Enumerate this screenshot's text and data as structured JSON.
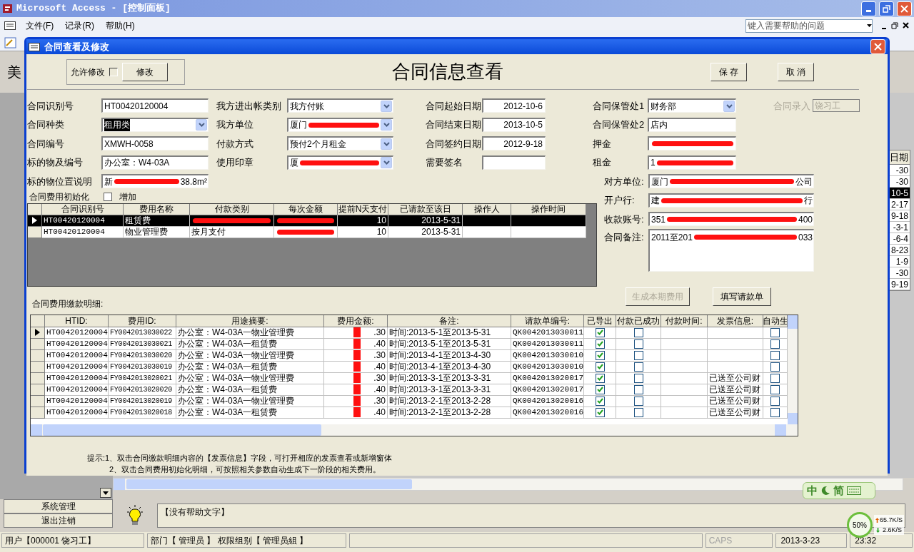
{
  "app": {
    "title": "Microsoft Access - [控制面板]",
    "menu": [
      "文件(F)",
      "记录(R)",
      "帮助(H)"
    ],
    "help_placeholder": "键入需要帮助的问题"
  },
  "background": {
    "big_char": "美",
    "date_header": "日期",
    "dates": [
      {
        "text": "-30",
        "selected": false
      },
      {
        "text": "-30",
        "selected": false
      },
      {
        "text": "10-5",
        "selected": true
      },
      {
        "text": "2-17",
        "selected": false
      },
      {
        "text": "9-18",
        "selected": false
      },
      {
        "text": "-3-1",
        "selected": false
      },
      {
        "text": "-6-4",
        "selected": false
      },
      {
        "text": "8-23",
        "selected": false
      },
      {
        "text": "1-9",
        "selected": false
      },
      {
        "text": "-30",
        "selected": false
      },
      {
        "text": "9-19",
        "selected": false
      }
    ],
    "nav": [
      "系统管理",
      "退出注销"
    ],
    "help_text": "【没有帮助文字】"
  },
  "status_bar": {
    "user": "用户【000001 饶习工】",
    "dept": "部门【 管理员 】 权限组别【 管理员組 】",
    "caps": "CAPS",
    "date": "2013-3-23",
    "time": "23:32"
  },
  "ime": [
    "中",
    "简"
  ],
  "net": {
    "percent": "50%",
    "up": "65.7K/S",
    "down": "2.6K/S"
  },
  "dialog": {
    "title": "合同查看及修改",
    "allow_edit": {
      "label": "允许修改",
      "checked": false
    },
    "edit_button": "修改",
    "heading": "合同信息查看",
    "buttons": [
      "保 存",
      "取 消"
    ],
    "columns": [
      [
        {
          "label": "合同识别号",
          "kind": "text",
          "parts": [
            {
              "kind": "text",
              "text": "HT00420120004"
            }
          ]
        },
        {
          "label": "合同种类",
          "kind": "combo",
          "selected": true,
          "parts": [
            {
              "kind": "text",
              "text": "租用类"
            }
          ]
        },
        {
          "label": "合同编号",
          "kind": "text",
          "parts": [
            {
              "kind": "text",
              "text": "XMWH-0058"
            }
          ]
        },
        {
          "label": "标的物及编号",
          "kind": "text",
          "parts": [
            {
              "kind": "text",
              "text": "办公室：W4-03A"
            }
          ]
        },
        {
          "label": "标的物位置说明",
          "kind": "text",
          "parts": [
            {
              "kind": "text",
              "text": "新"
            },
            {
              "kind": "redaction"
            },
            {
              "kind": "text",
              "text": "38.8m²"
            }
          ]
        }
      ],
      [
        {
          "label": "我方进出帐类别",
          "kind": "combo",
          "parts": [
            {
              "kind": "text",
              "text": "我方付账"
            }
          ]
        },
        {
          "label": "我方单位",
          "kind": "combo",
          "parts": [
            {
              "kind": "text",
              "text": "厦门"
            },
            {
              "kind": "redaction"
            }
          ]
        },
        {
          "label": "付款方式",
          "kind": "combo",
          "parts": [
            {
              "kind": "text",
              "text": "预付2个月租金"
            }
          ]
        },
        {
          "label": "使用印章",
          "kind": "combo",
          "parts": [
            {
              "kind": "text",
              "text": "厦"
            },
            {
              "kind": "redaction"
            }
          ]
        }
      ],
      [
        {
          "label": "合同起始日期",
          "kind": "date",
          "parts": [
            {
              "kind": "text",
              "text": "2012-10-6"
            }
          ]
        },
        {
          "label": "合同结束日期",
          "kind": "date",
          "parts": [
            {
              "kind": "text",
              "text": "2013-10-5"
            }
          ]
        },
        {
          "label": "合同签约日期",
          "kind": "date",
          "parts": [
            {
              "kind": "text",
              "text": "2012-9-18"
            }
          ]
        },
        {
          "label": "需要签名",
          "kind": "text"
        }
      ],
      [
        {
          "label": "合同保管处1",
          "kind": "combo",
          "parts": [
            {
              "kind": "text",
              "text": "财务部"
            }
          ]
        },
        {
          "label": "合同保管处2",
          "kind": "text",
          "parts": [
            {
              "kind": "text",
              "text": "店内"
            }
          ]
        },
        {
          "label": "押金",
          "kind": "text",
          "parts": [
            {
              "kind": "redaction"
            }
          ]
        },
        {
          "label": "租金",
          "kind": "text",
          "parts": [
            {
              "kind": "text",
              "text": "1"
            },
            {
              "kind": "redaction"
            }
          ]
        }
      ]
    ],
    "entry": {
      "label": "合同录入",
      "value": "饶习工",
      "disabled": true
    },
    "party_fields": [
      {
        "label": "对方单位:",
        "kind": "text",
        "parts": [
          {
            "kind": "text",
            "text": "厦门"
          },
          {
            "kind": "redaction"
          },
          {
            "kind": "text",
            "text": "公司"
          }
        ]
      },
      {
        "label": "开户行:",
        "kind": "text",
        "parts": [
          {
            "kind": "text",
            "text": "建"
          },
          {
            "kind": "redaction"
          },
          {
            "kind": "text",
            "text": "行"
          }
        ]
      },
      {
        "label": "收款账号:",
        "kind": "text",
        "parts": [
          {
            "kind": "text",
            "text": "351"
          },
          {
            "kind": "redaction"
          },
          {
            "kind": "text",
            "text": "400"
          }
        ]
      },
      {
        "label": "合同备注:",
        "kind": "textarea",
        "parts": [
          {
            "kind": "text",
            "text": "2011至201"
          },
          {
            "kind": "redaction"
          },
          {
            "kind": "text",
            "text": "033"
          }
        ]
      }
    ],
    "init": {
      "label": "合同费用初始化",
      "checkbox_label": "增加",
      "checked": false
    },
    "fee_grid": {
      "columns": [
        "合同识别号",
        "费用名称",
        "付款类别",
        "每次金额",
        "提前N天支付",
        "已请款至该日",
        "操作人",
        "操作时间"
      ],
      "rows": [
        {
          "selected": true,
          "cells": [
            [
              {
                "kind": "text",
                "text": "HT00420120004"
              }
            ],
            [
              {
                "kind": "text",
                "text": "租赁费"
              }
            ],
            [
              {
                "kind": "redaction"
              }
            ],
            [
              {
                "kind": "redaction"
              }
            ],
            [
              {
                "kind": "text",
                "text": "10"
              }
            ],
            [
              {
                "kind": "text",
                "text": "2013-5-31"
              }
            ],
            [],
            []
          ]
        },
        {
          "selected": false,
          "cells": [
            [
              {
                "kind": "text",
                "text": "HT00420120004"
              }
            ],
            [
              {
                "kind": "text",
                "text": "物业管理费"
              }
            ],
            [
              {
                "kind": "text",
                "text": "按月支付"
              }
            ],
            [
              {
                "kind": "redaction"
              }
            ],
            [
              {
                "kind": "text",
                "text": "10"
              }
            ],
            [
              {
                "kind": "text",
                "text": "2013-5-31"
              }
            ],
            [],
            []
          ]
        }
      ]
    },
    "action_buttons": [
      {
        "label": "生成本期费用",
        "disabled": true
      },
      {
        "label": "填写请款单",
        "disabled": false
      }
    ],
    "payments_label": "合同费用缴款明细:",
    "payments": {
      "columns": [
        "HTID:",
        "费用ID:",
        "用途摘要:",
        "费用金额:",
        "备注:",
        "请款单编号:",
        "已导出",
        "付款已成功",
        "付款时间:",
        "发票信息:",
        "自动生"
      ],
      "rows": [
        {
          "selected": true,
          "htid": "HT00420120004",
          "fee_id": "FY0042013030022",
          "summary": "办公室：W4-03A一物业管理费",
          "amount": ".30",
          "note": "时间:2013-5-1至2013-5-31",
          "request_no": "QK0042013030011",
          "exported": true,
          "paid": false,
          "auto": false
        },
        {
          "selected": false,
          "htid": "HT00420120004",
          "fee_id": "FY0042013030021",
          "summary": "办公室：W4-03A一租赁费",
          "amount": ".40",
          "note": "时间:2013-5-1至2013-5-31",
          "request_no": "QK0042013030011",
          "exported": true,
          "paid": false,
          "auto": false
        },
        {
          "selected": false,
          "htid": "HT00420120004",
          "fee_id": "FY0042013030020",
          "summary": "办公室：W4-03A一物业管理费",
          "amount": ".30",
          "note": "时间:2013-4-1至2013-4-30",
          "request_no": "QK0042013030010",
          "exported": true,
          "paid": false,
          "auto": false
        },
        {
          "selected": false,
          "htid": "HT00420120004",
          "fee_id": "FY0042013030019",
          "summary": "办公室：W4-03A一租赁费",
          "amount": ".40",
          "note": "时间:2013-4-1至2013-4-30",
          "request_no": "QK0042013030010",
          "exported": true,
          "paid": false,
          "auto": false
        },
        {
          "selected": false,
          "htid": "HT00420120004",
          "fee_id": "FY0042013020021",
          "summary": "办公室：W4-03A一物业管理费",
          "amount": ".30",
          "note": "时间:2013-3-1至2013-3-31",
          "request_no": "QK0042013020017",
          "exported": true,
          "paid": false,
          "invoice": "已送至公司财",
          "auto": false
        },
        {
          "selected": false,
          "htid": "HT00420120004",
          "fee_id": "FY0042013020020",
          "summary": "办公室：W4-03A一租赁费",
          "amount": ".40",
          "note": "时间:2013-3-1至2013-3-31",
          "request_no": "QK0042013020017",
          "exported": true,
          "paid": false,
          "invoice": "已送至公司财",
          "auto": false
        },
        {
          "selected": false,
          "htid": "HT00420120004",
          "fee_id": "FY0042013020019",
          "summary": "办公室：W4-03A一物业管理费",
          "amount": ".30",
          "note": "时间:2013-2-1至2013-2-28",
          "request_no": "QK0042013020016",
          "exported": true,
          "paid": false,
          "invoice": "已送至公司财",
          "auto": false
        },
        {
          "selected": false,
          "htid": "HT00420120004",
          "fee_id": "FY0042013020018",
          "summary": "办公室：W4-03A一租赁费",
          "amount": ".40",
          "note": "时间:2013-2-1至2013-2-28",
          "request_no": "QK0042013020016",
          "exported": true,
          "paid": false,
          "invoice": "已送至公司财",
          "auto": false
        }
      ]
    },
    "hints": [
      "提示:1、双击合同缴款明细内容的【发票信息】字段，可打开相应的发票查看或新增窗体",
      "2、双击合同费用初始化明细，可按照相关参数自动生成下一阶段的相关费用。"
    ]
  }
}
